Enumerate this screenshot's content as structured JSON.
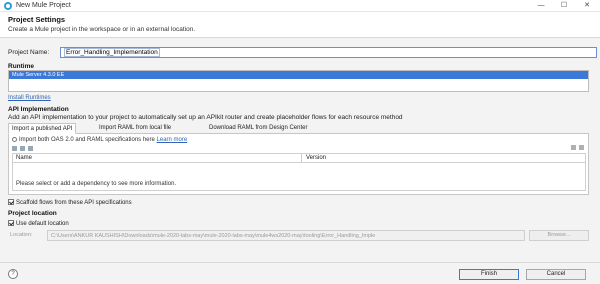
{
  "window": {
    "title": "New Mule Project",
    "buttons": {
      "minimize": "—",
      "maximize": "☐",
      "close": "✕"
    }
  },
  "header": {
    "title": "Project Settings",
    "description": "Create a Mule project in the workspace or in an external location."
  },
  "project": {
    "name_label": "Project Name:",
    "name_value": "Error_Handling_Implementation"
  },
  "runtime": {
    "section_title": "Runtime",
    "selected": "Mule Server 4.3.0 EE",
    "install_link": "Install Runtimes"
  },
  "api": {
    "section_title": "API Implementation",
    "description": "Add an API implementation to your project to automatically set up an APIkit router and create placeholder flows for each resource method",
    "tabs": [
      {
        "label": "Import a published API",
        "active": true
      },
      {
        "label": "Import RAML from local file",
        "active": false
      },
      {
        "label": "Download RAML from Design Center",
        "active": false
      }
    ],
    "info_text": "Import both OAS 2.0 and RAML specifications here",
    "learn_more": "Learn more",
    "table": {
      "columns": [
        "Name",
        "Version"
      ],
      "empty_message": "Please select or add a dependency to see more information."
    },
    "scaffold_label": "Scaffold flows from these API specifications",
    "scaffold_checked": true
  },
  "location": {
    "section_title": "Project location",
    "use_default_label": "Use default location",
    "use_default_checked": true,
    "location_label": "Location:",
    "location_value": "C:\\Users\\ANKUR KAUSHISH\\Downloads\\mule-2020-labs-may\\mule-2020-labs-may\\mule4ws2020-may\\tooling\\Error_Handling_Imple",
    "browse_label": "Browse..."
  },
  "footer": {
    "help": "?",
    "finish": "Finish",
    "cancel": "Cancel"
  },
  "colors": {
    "accent": "#3c78d8",
    "link": "#2f63b6"
  }
}
